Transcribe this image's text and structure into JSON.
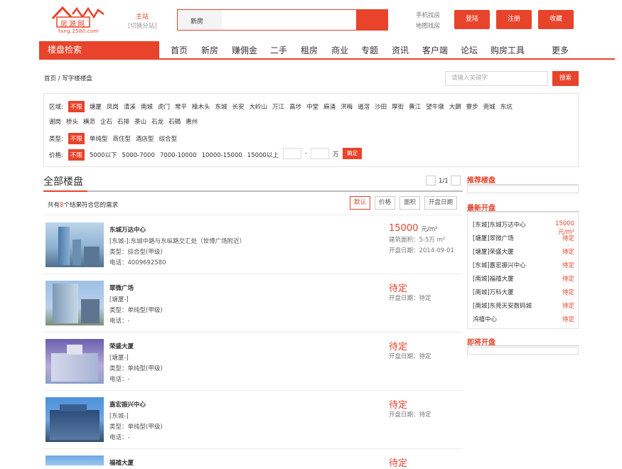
{
  "header": {
    "logo_text": "fang.2580.com",
    "logo_chars": "房源网",
    "site_main": "主站",
    "site_switch": "[切换分站]",
    "search_type": "新房",
    "search_placeholder": "",
    "top_link_mobile": "手机找房",
    "top_link_map": "地图找房",
    "login": "登陆",
    "register": "注册",
    "favorite": "收藏"
  },
  "nav": {
    "title": "楼盘检索",
    "items": [
      "首页",
      "新房",
      "赚佣金",
      "二手",
      "租房",
      "商业",
      "专题",
      "资讯",
      "客户端",
      "论坛",
      "购房工具",
      "更多"
    ],
    "active_index": 5
  },
  "breadcrumb": {
    "home": "首页",
    "sep": "/",
    "current": "写字楼楼盘"
  },
  "keyword": {
    "placeholder": "请输入关键字",
    "button": "搜索"
  },
  "filters": {
    "region_label": "区域:",
    "region_row1": [
      "不限",
      "塘厦",
      "凤岗",
      "清溪",
      "南城",
      "虎门",
      "常平",
      "樟木头",
      "东城",
      "长安",
      "大岭山",
      "万江",
      "高埗",
      "中堂",
      "麻涌",
      "洪梅",
      "道滘",
      "沙田",
      "厚街",
      "黄江",
      "望牛墩",
      "大朗",
      "寮步",
      "莞城",
      "东坑"
    ],
    "region_row2": [
      "谢岗",
      "桥头",
      "横沥",
      "企石",
      "石排",
      "茶山",
      "石龙",
      "石碣",
      "惠州"
    ],
    "type_label": "类型:",
    "types": [
      "不限",
      "单纯型",
      "商住型",
      "酒店型",
      "综合型"
    ],
    "price_label": "价格:",
    "prices": [
      "不限",
      "5000以下",
      "5000-7000",
      "7000-10000",
      "10000-15000",
      "15000以上"
    ],
    "price_dash": "-",
    "price_unit": "万",
    "price_ok": "确定"
  },
  "list": {
    "title": "全部楼盘",
    "page": "1/1",
    "count_prefix": "共有",
    "count": "8",
    "count_suffix": "个结果符合您的需求",
    "sorts": [
      "默认",
      "价格",
      "面积",
      "开盘日期"
    ],
    "items": [
      {
        "name": "东城万达中心",
        "addr": "[东城-]:东城中路与东纵路交汇处（世博广场附近）",
        "type": "类型：综合型(甲级)",
        "phone": "电话：4009692580",
        "price": "15000",
        "price_unit": "元/m²",
        "area": "建筑面积：5-5万 m²",
        "open": "开盘日期：2014-09-01"
      },
      {
        "name": "翠微广场",
        "addr": "[塘厦-]",
        "type": "类型：单纯型(甲级)",
        "phone": "电话：-",
        "price": "待定",
        "open": "开盘日期：待定"
      },
      {
        "name": "荣盛大厦",
        "addr": "[塘厦-]",
        "type": "类型：单纯型(甲级)",
        "phone": "电话：-",
        "price": "待定",
        "open": "开盘日期：待定"
      },
      {
        "name": "嘉宏振兴中心",
        "addr": "[东城-]",
        "type": "类型：单纯型(甲级)",
        "phone": "电话：-",
        "price": "待定",
        "open": "开盘日期：待定"
      },
      {
        "name": "福禧大厦",
        "price": "待定"
      }
    ]
  },
  "sidebar": {
    "recommend_title": "推荐楼盘",
    "latest_title": "最新开盘",
    "latest": [
      {
        "name": "[东城]东城万达中心",
        "val": "15000元/m²"
      },
      {
        "name": "[塘厦]翠微广场",
        "val": "待定"
      },
      {
        "name": "[塘厦]荣盛大厦",
        "val": "待定"
      },
      {
        "name": "[东城]嘉宏振兴中心",
        "val": "待定"
      },
      {
        "name": "[南城]福禧大厦",
        "val": "待定"
      },
      {
        "name": "[南城]万科大厦",
        "val": "待定"
      },
      {
        "name": "[南城]东莞天安数码城",
        "val": "待定"
      },
      {
        "name": "鸿禧中心",
        "val": "待定"
      }
    ],
    "upcoming_title": "即将开盘"
  },
  "colors": {
    "accent": "#e8432b"
  }
}
